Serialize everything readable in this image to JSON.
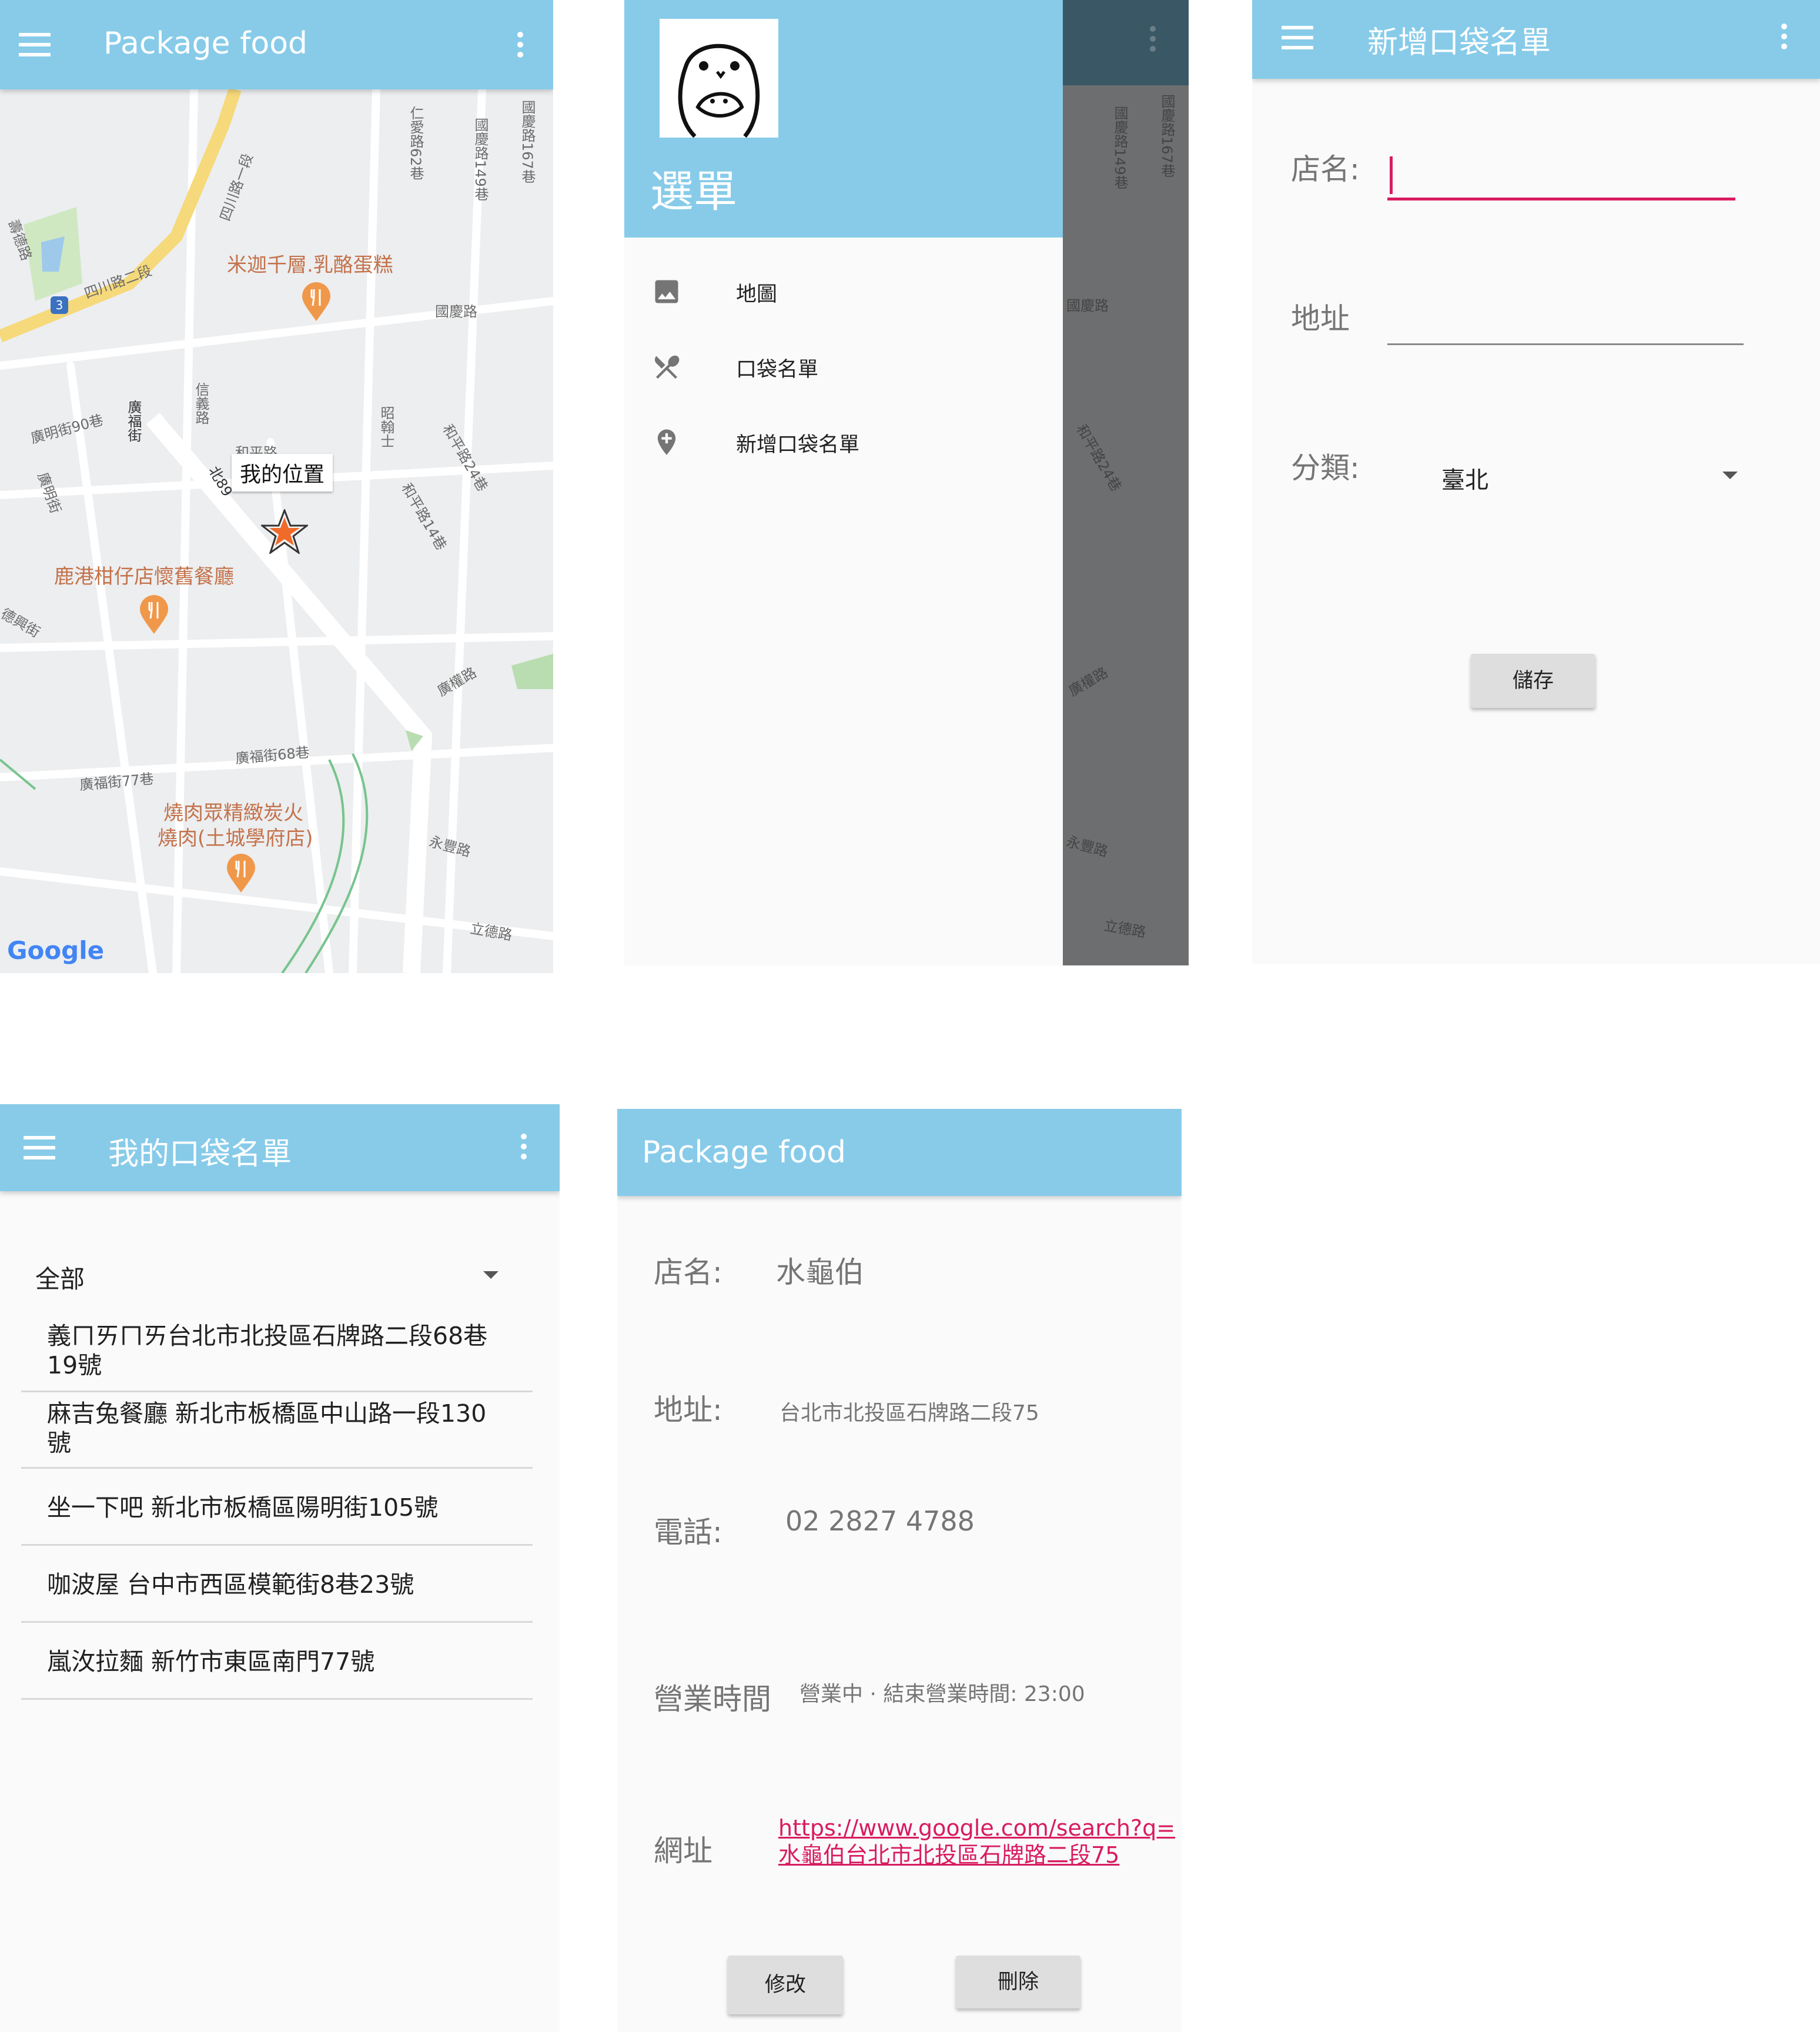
{
  "map_screen": {
    "title": "Package food",
    "my_location": "我的位置",
    "places": [
      "米迦千層.乳酪蛋糕",
      "鹿港柑仔店懷舊餐廳",
      "燒肉眾精緻炭火",
      "燒肉(土城學府店)"
    ],
    "streets": [
      "四川路一段",
      "四川路二段",
      "仁愛路62巷",
      "國慶路149巷",
      "國慶路167巷",
      "國慶路",
      "廣明街90巷",
      "廣福街",
      "信義路",
      "和平路",
      "北89",
      "昭翰士",
      "和平路24巷",
      "和平路14巷",
      "廣明街",
      "德興街",
      "廣福街77巷",
      "廣福街68巷",
      "廣權路",
      "永豐路",
      "立德路",
      "壽德路"
    ],
    "route_badge": "3",
    "google_logo": "Google"
  },
  "drawer": {
    "title": "選單",
    "items": [
      {
        "label": "地圖",
        "icon": "image-icon"
      },
      {
        "label": "口袋名單",
        "icon": "utensils-icon"
      },
      {
        "label": "新增口袋名單",
        "icon": "add-location-icon"
      }
    ],
    "bg_streets": [
      "國慶路149巷",
      "國慶路167巷",
      "國慶路",
      "和平路24巷",
      "廣權路",
      "永豐路",
      "立德路"
    ]
  },
  "add_screen": {
    "title": "新增口袋名單",
    "name_label": "店名:",
    "address_label": "地址",
    "category_label": "分類:",
    "category_value": "臺北",
    "save_label": "儲存"
  },
  "list_screen": {
    "title": "我的口袋名單",
    "filter_value": "全部",
    "items": [
      {
        "line1": "義ㄇㄞㄇㄞ台北市北投區石牌路二段68巷",
        "line2": "19號"
      },
      {
        "line1": "麻吉兔餐廳  新北市板橋區中山路一段130",
        "line2": "號"
      },
      {
        "line1": "坐一下吧 新北市板橋區陽明街105號",
        "line2": ""
      },
      {
        "line1": "咖波屋  台中市西區模範街8巷23號",
        "line2": ""
      },
      {
        "line1": "嵐㳊拉麵 新竹市東區南門77號",
        "line2": ""
      }
    ]
  },
  "detail_screen": {
    "title": "Package food",
    "name_label": "店名:",
    "name_value": "水龜伯",
    "address_label": "地址:",
    "address_value": "台北市北投區石牌路二段75",
    "phone_label": "電話:",
    "phone_value": "02 2827 4788",
    "hours_label": "營業時間",
    "hours_value": "營業中 · 結束營業時間: 23:00",
    "url_label": "網址",
    "url_line1": "https://www.google.com/search?q=",
    "url_line2": "水龜伯台北市北投區石牌路二段75",
    "edit_label": "修改",
    "delete_label": "刪除"
  },
  "colors": {
    "appbar": "#87cbe9",
    "accent": "#d81b60",
    "map_label": "#c4724a",
    "pin": "#f0984a"
  }
}
